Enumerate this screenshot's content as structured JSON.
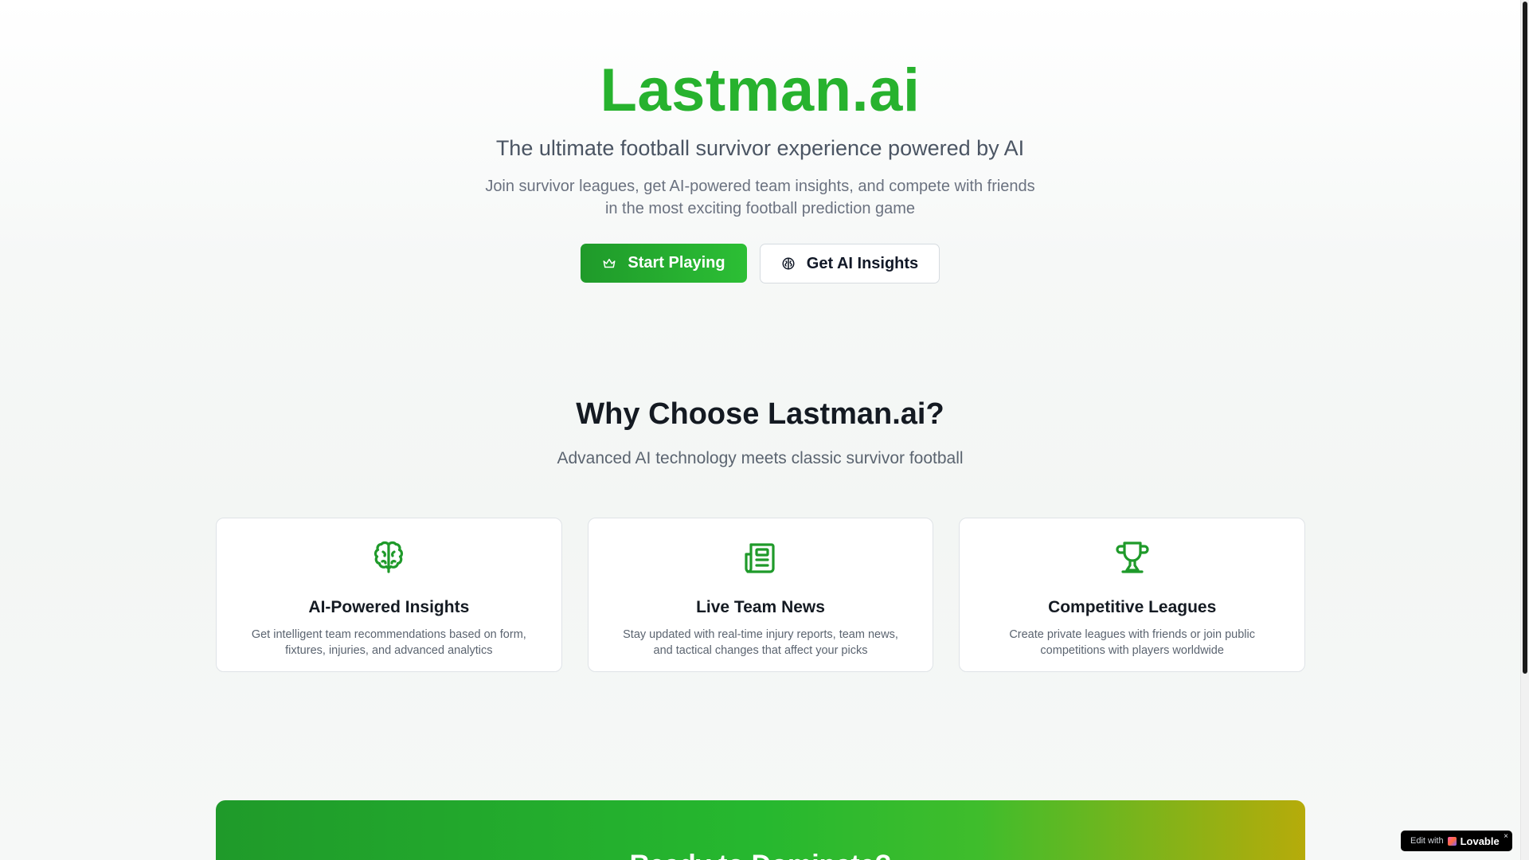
{
  "hero": {
    "brand": "Lastman.ai",
    "tagline": "The ultimate football survivor experience powered by AI",
    "description": "Join survivor leagues, get AI-powered team insights, and compete with friends in the most exciting football prediction game",
    "primary_button": "Start Playing",
    "secondary_button": "Get AI Insights"
  },
  "why": {
    "title": "Why Choose Lastman.ai?",
    "subtitle": "Advanced AI technology meets classic survivor football",
    "cards": [
      {
        "icon": "brain-icon",
        "title": "AI-Powered Insights",
        "text": "Get intelligent team recommendations based on form, fixtures, injuries, and advanced analytics"
      },
      {
        "icon": "newspaper-icon",
        "title": "Live Team News",
        "text": "Stay updated with real-time injury reports, team news, and tactical changes that affect your picks"
      },
      {
        "icon": "trophy-icon",
        "title": "Competitive Leagues",
        "text": "Create private leagues with friends or join public competitions with players worldwide"
      }
    ]
  },
  "banner": {
    "title": "Ready to Dominate?"
  },
  "lovable_badge": {
    "prefix": "Edit with",
    "name": "Lovable",
    "close": "×"
  },
  "colors": {
    "brand_green": "#27b22e",
    "icon_green": "#1f9a2a",
    "banner_end": "#b6ab0a"
  }
}
